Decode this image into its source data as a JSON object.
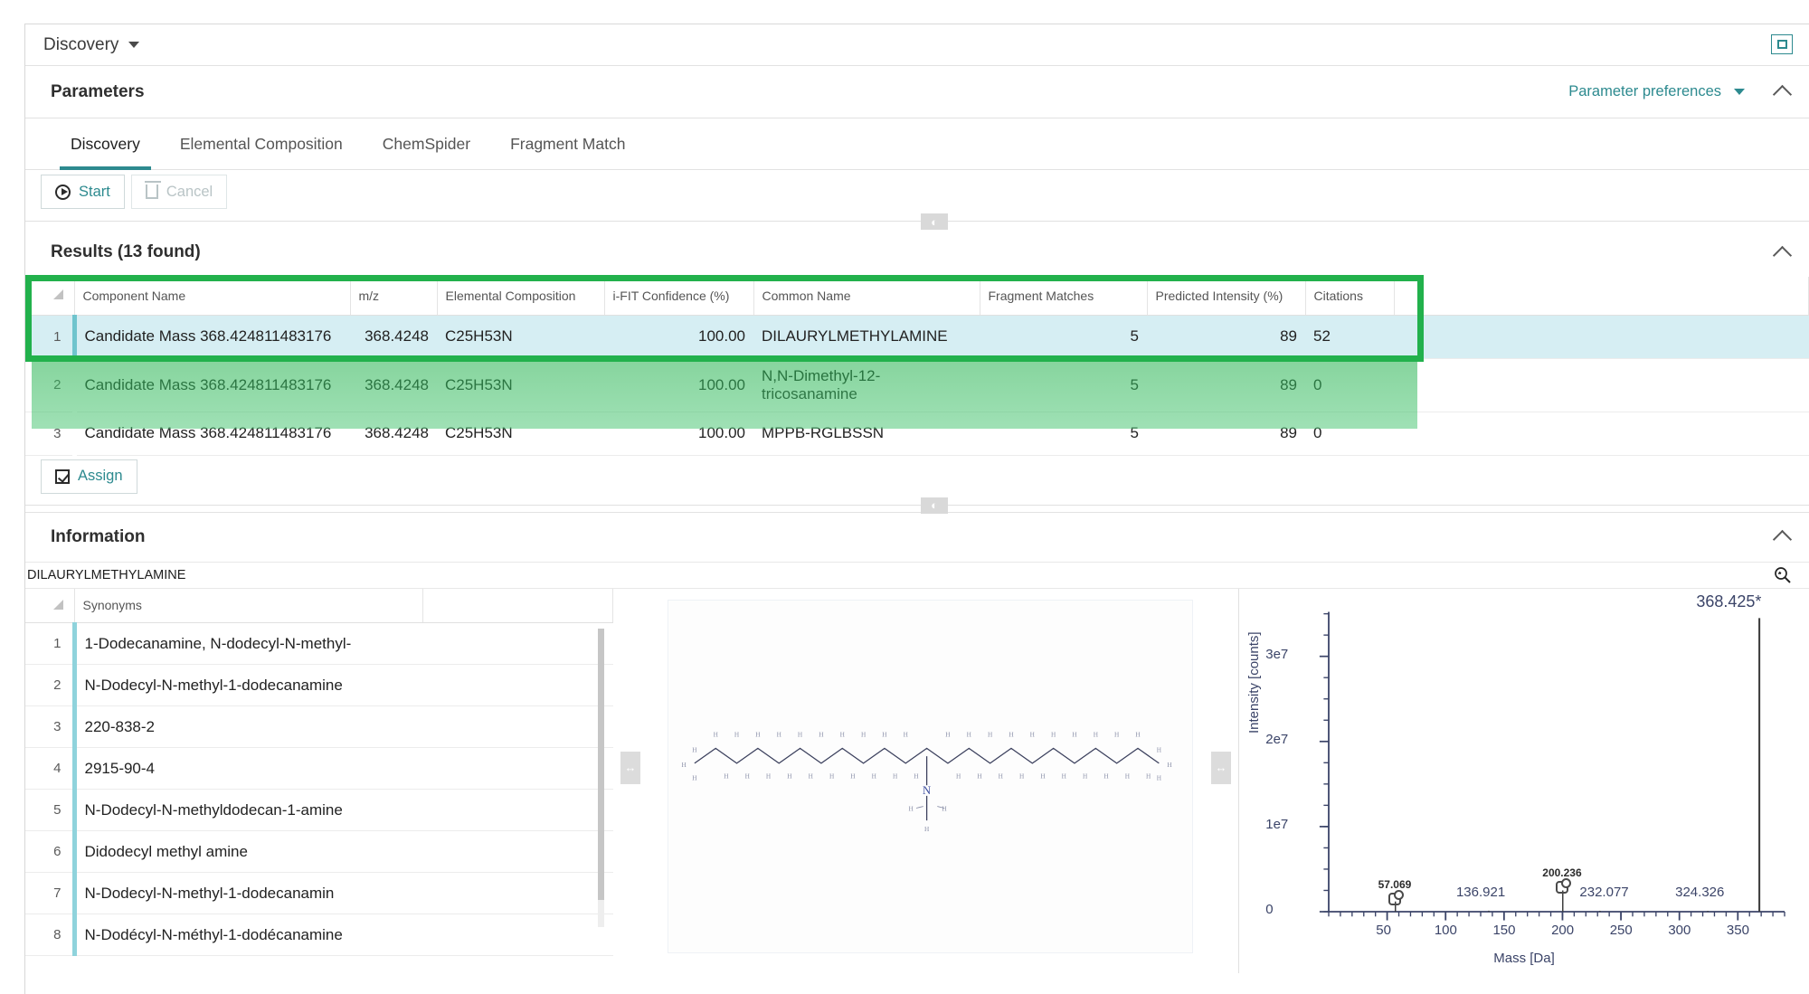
{
  "window": {
    "title": "Discovery",
    "title_caret": "caret-down-icon",
    "restore_icon": "restore-window-icon"
  },
  "parameters": {
    "heading": "Parameters",
    "preferences_label": "Parameter preferences",
    "collapse_icon": "chevron-up-icon"
  },
  "tabs": [
    {
      "label": "Discovery",
      "active": true
    },
    {
      "label": "Elemental Composition",
      "active": false
    },
    {
      "label": "ChemSpider",
      "active": false
    },
    {
      "label": "Fragment Match",
      "active": false
    }
  ],
  "actions": {
    "start_label": "Start",
    "cancel_label": "Cancel",
    "assign_label": "Assign"
  },
  "results": {
    "heading": "Results (13 found)",
    "columns": [
      "",
      "Component Name",
      "m/z",
      "Elemental Composition",
      "i-FIT Confidence (%)",
      "Common Name",
      "Fragment Matches",
      "Predicted Intensity (%)",
      "Citations",
      ""
    ],
    "rows": [
      {
        "index": "1",
        "component_name": "Candidate Mass 368.424811483176",
        "mz": "368.4248",
        "elemental_composition": "C25H53N",
        "ifit": "100.00",
        "common_name": "DILAURYLMETHYLAMINE",
        "fragment_matches": "5",
        "predicted_intensity": "89",
        "citations": "52",
        "selected": true
      },
      {
        "index": "2",
        "component_name": "Candidate Mass 368.424811483176",
        "mz": "368.4248",
        "elemental_composition": "C25H53N",
        "ifit": "100.00",
        "common_name": "N,N-Dimethyl-12-tricosanamine",
        "fragment_matches": "5",
        "predicted_intensity": "89",
        "citations": "0",
        "selected": false
      },
      {
        "index": "3",
        "component_name": "Candidate Mass 368.424811483176",
        "mz": "368.4248",
        "elemental_composition": "C25H53N",
        "ifit": "100.00",
        "common_name": "MPPB-RGLBSSN",
        "fragment_matches": "5",
        "predicted_intensity": "89",
        "citations": "0",
        "selected": false
      }
    ]
  },
  "information": {
    "heading": "Information",
    "compound_name": "DILAURYLMETHYLAMINE",
    "search_icon": "magnifier-icon",
    "collapse_icon": "chevron-up-icon",
    "synonyms_header": "Synonyms",
    "synonyms": [
      {
        "index": "1",
        "name": "1-Dodecanamine, N-dodecyl-N-methyl-"
      },
      {
        "index": "2",
        "name": "N-Dodecyl-N-methyl-1-dodecanamine"
      },
      {
        "index": "3",
        "name": "220-838-2"
      },
      {
        "index": "4",
        "name": "2915-90-4"
      },
      {
        "index": "5",
        "name": "N-Dodecyl-N-methyldodecan-1-amine"
      },
      {
        "index": "6",
        "name": "Didodecyl methyl amine"
      },
      {
        "index": "7",
        "name": "N-Dodecyl-N-methyl-1-dodecanamin"
      },
      {
        "index": "8",
        "name": "N-Dodécyl-N-méthyl-1-dodécanamine"
      }
    ],
    "structure_center_atom": "N"
  },
  "chart_data": {
    "type": "bar",
    "title": "",
    "xlabel": "Mass [Da]",
    "ylabel": "Intensity [counts]",
    "xlim": [
      0,
      390
    ],
    "ylim": [
      0,
      35000000
    ],
    "xticks": [
      50,
      100,
      150,
      200,
      250,
      300,
      350
    ],
    "xtick_labels": [
      "50",
      "100",
      "150",
      "200",
      "250",
      "300",
      "350"
    ],
    "yticks": [
      0,
      10000000,
      20000000,
      30000000
    ],
    "ytick_labels": [
      "0",
      "1e7",
      "2e7",
      "3e7"
    ],
    "grid": false,
    "legend": "none",
    "x": [
      57.069,
      136.921,
      200.236,
      232.077,
      324.326,
      368.425
    ],
    "values": [
      1200000,
      120000,
      2500000,
      110000,
      100000,
      34500000
    ],
    "labels": [
      "57.069",
      "136.921",
      "200.236",
      "232.077",
      "324.326",
      "368.425*"
    ],
    "annotated_structures": [
      "57.069",
      "200.236"
    ]
  },
  "splitters": {
    "vertical_grab_icon": "vertical-resize-handle",
    "horizontal_grab_icon": "horizontal-resize-handle"
  }
}
